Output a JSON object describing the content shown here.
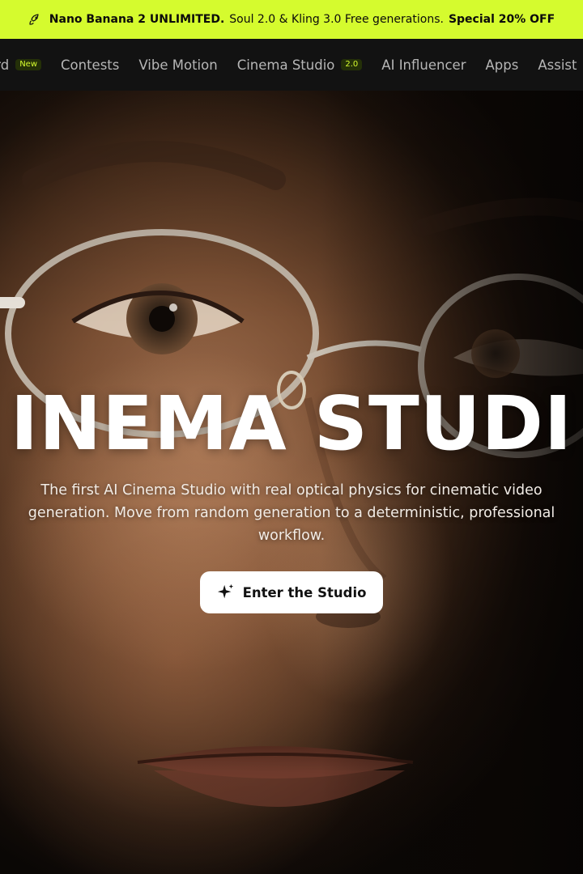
{
  "promo": {
    "strong_1": "Nano Banana 2 UNLIMITED.",
    "text": "Soul 2.0 & Kling 3.0 Free generations.",
    "strong_2": "Special 20% OFF",
    "icon": "rocket-icon",
    "background": "#d5fb2e"
  },
  "nav": {
    "items": [
      {
        "label": "oard",
        "tag": "New"
      },
      {
        "label": "Contests"
      },
      {
        "label": "Vibe Motion"
      },
      {
        "label": "Cinema Studio",
        "tag": "2.0"
      },
      {
        "label": "AI Influencer"
      },
      {
        "label": "Apps"
      },
      {
        "label": "Assist"
      }
    ],
    "accent": "#d5fb2e"
  },
  "hero": {
    "title": "INEMA STUDI",
    "subtitle": "The first AI Cinema Studio with real optical physics for cinematic video generation. Move from random generation to a deterministic, professional workflow.",
    "cta_label": "Enter the Studio",
    "cta_icon": "sparkle-icon"
  }
}
